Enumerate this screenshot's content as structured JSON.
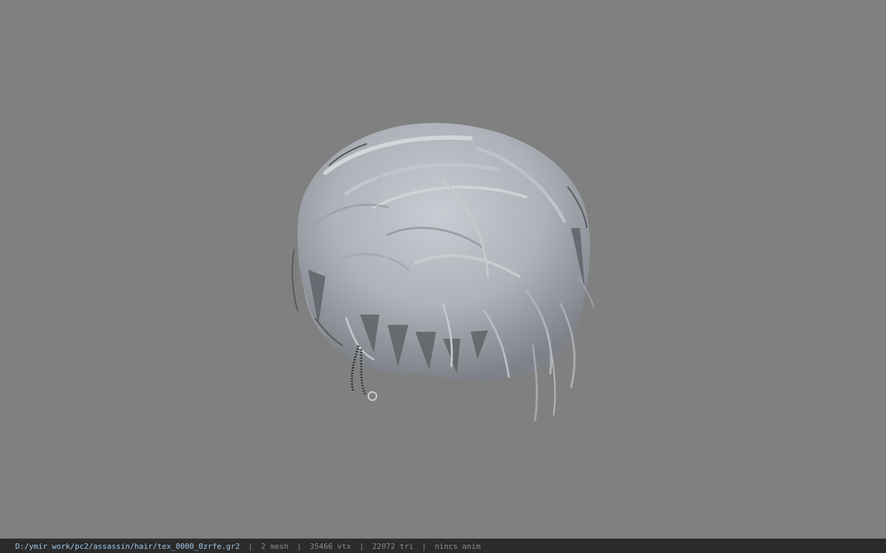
{
  "viewport": {
    "background_color": "#808080",
    "model": {
      "name": "hair-model",
      "hair_color": "#b9bdc4",
      "accessory": "chain-earring"
    }
  },
  "statusbar": {
    "file_path": "D:/ymir work/pc2/assassin/hair/tex_0000_0zrfe.gr2",
    "separator": "|",
    "mesh_count": "2 mesh",
    "vertex_count": "35466 vtx",
    "triangle_count": "22072 tri",
    "anim_status": "nincs anim",
    "path_color": "#9ec7e8"
  }
}
